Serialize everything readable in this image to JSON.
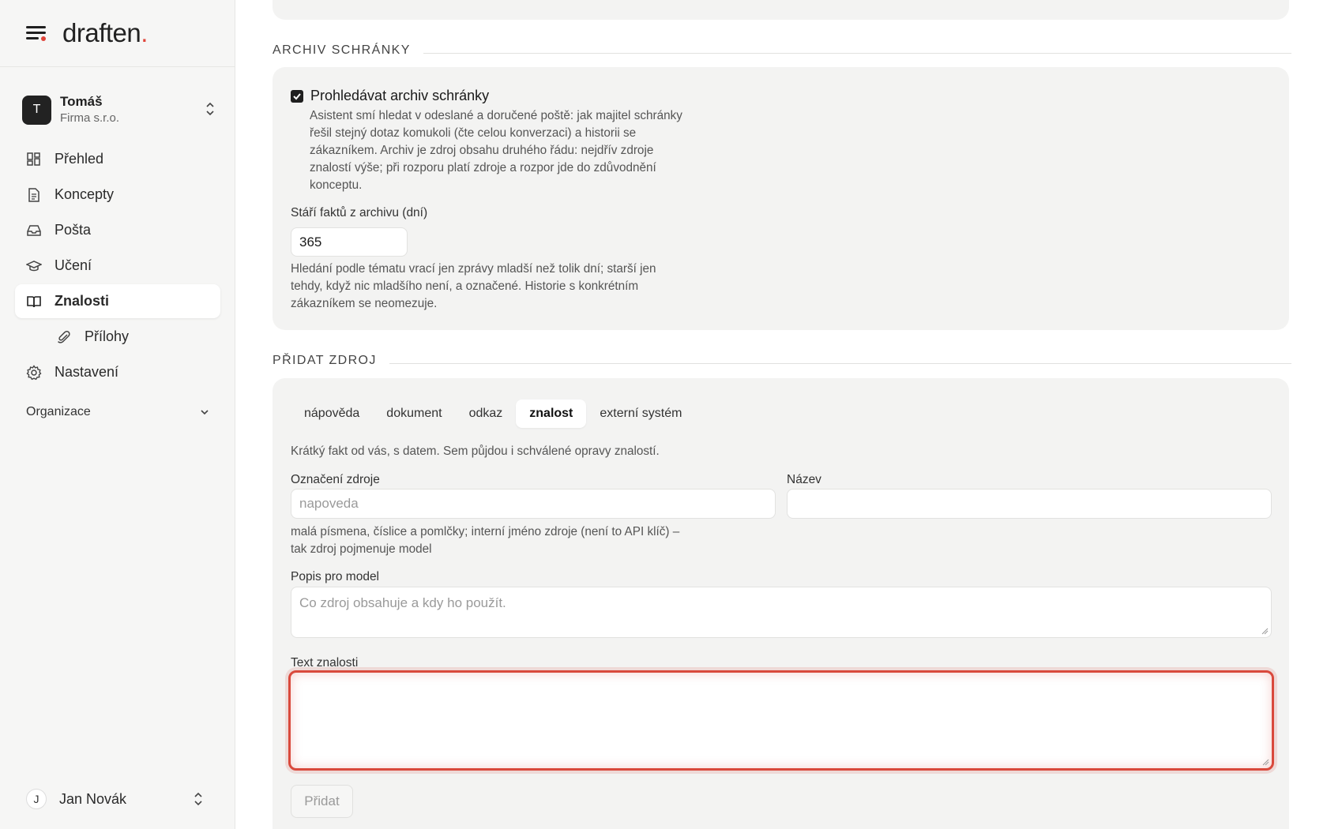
{
  "brand": {
    "name": "draften",
    "dot": "."
  },
  "account": {
    "initial": "T",
    "name": "Tomáš",
    "org": "Firma s.r.o."
  },
  "nav": {
    "items": [
      {
        "label": "Přehled",
        "icon": "dashboard-icon"
      },
      {
        "label": "Koncepty",
        "icon": "document-icon"
      },
      {
        "label": "Pošta",
        "icon": "inbox-icon"
      },
      {
        "label": "Učení",
        "icon": "graduation-cap-icon"
      },
      {
        "label": "Znalosti",
        "icon": "book-icon",
        "active": true
      },
      {
        "label": "Přílohy",
        "icon": "paperclip-icon",
        "sub": true
      },
      {
        "label": "Nastavení",
        "icon": "gear-icon"
      }
    ],
    "org_label": "Organizace"
  },
  "user": {
    "initial": "J",
    "name": "Jan Novák"
  },
  "archive": {
    "heading": "ARCHIV SCHRÁNKY",
    "checkbox_label": "Prohledávat archiv schránky",
    "checked": true,
    "checkbox_desc": [
      "Asistent smí hledat v odeslané a doručené poště: jak majitel schránky",
      "řešil stejný dotaz komukoli (čte celou konverzaci) a historii se",
      "zákazníkem. Archiv je zdroj obsahu druhého řádu: nejdřív zdroje",
      "znalostí výše; při rozporu platí zdroje a rozpor jde do zdůvodnění",
      "konceptu."
    ],
    "age_label": "Stáří faktů z archivu (dní)",
    "age_value": "365",
    "age_desc": [
      "Hledání podle tématu vrací jen zprávy mladší než tolik dní; starší jen",
      "tehdy, když nic mladšího není, a označené. Historie s konkrétním",
      "zákazníkem se neomezuje."
    ]
  },
  "add_source": {
    "heading": "PŘIDAT ZDROJ",
    "tabs": [
      "nápověda",
      "dokument",
      "odkaz",
      "znalost",
      "externí systém"
    ],
    "active_tab": "znalost",
    "intro": "Krátký fakt od vás, s datem. Sem půjdou i schválené opravy znalostí.",
    "id_label": "Označení zdroje",
    "id_placeholder": "napoveda",
    "name_label": "Název",
    "name_value": "",
    "id_hint": [
      "malá písmena, číslice a pomlčky; interní jméno zdroje (není to API klíč) –",
      "tak zdroj pojmenuje model"
    ],
    "model_desc_label": "Popis pro model",
    "model_desc_placeholder": "Co zdroj obsahuje a kdy ho použít.",
    "knowledge_label": "Text znalosti",
    "knowledge_value": "",
    "submit_label": "Přidat"
  },
  "colors": {
    "accent": "#e0453a",
    "focus": "#d9493c"
  }
}
